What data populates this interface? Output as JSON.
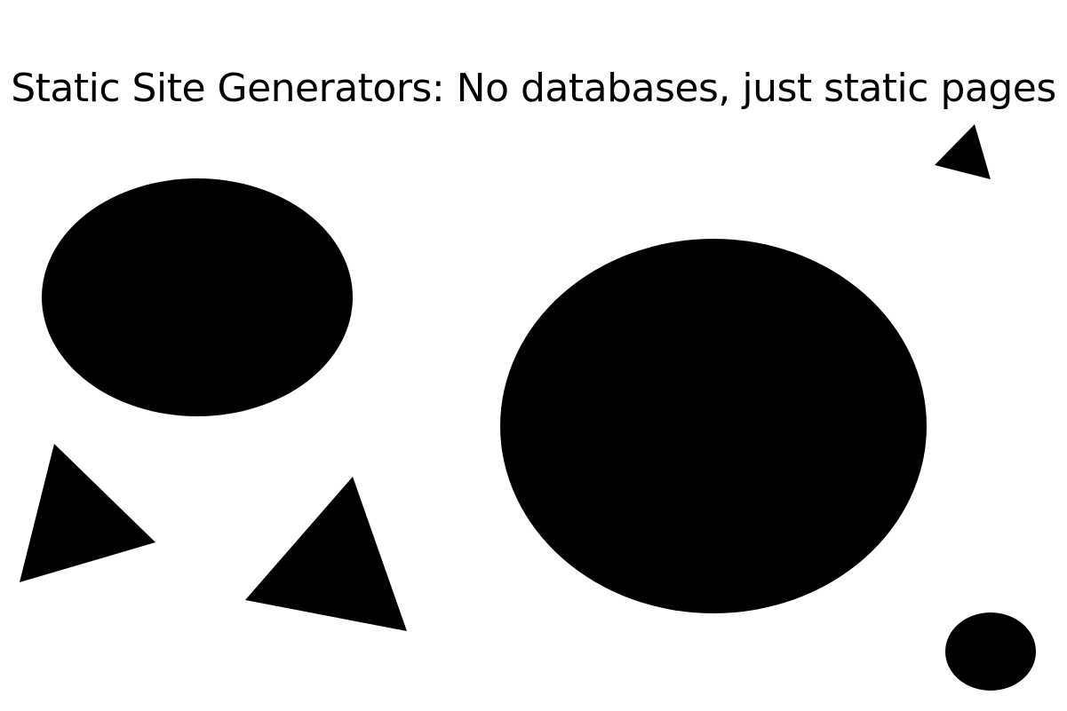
{
  "title": "Static Site Generators: No databases, just static pages",
  "colors": {
    "background": "#ffffff",
    "shape_fill": "#000000",
    "text": "#000000"
  }
}
